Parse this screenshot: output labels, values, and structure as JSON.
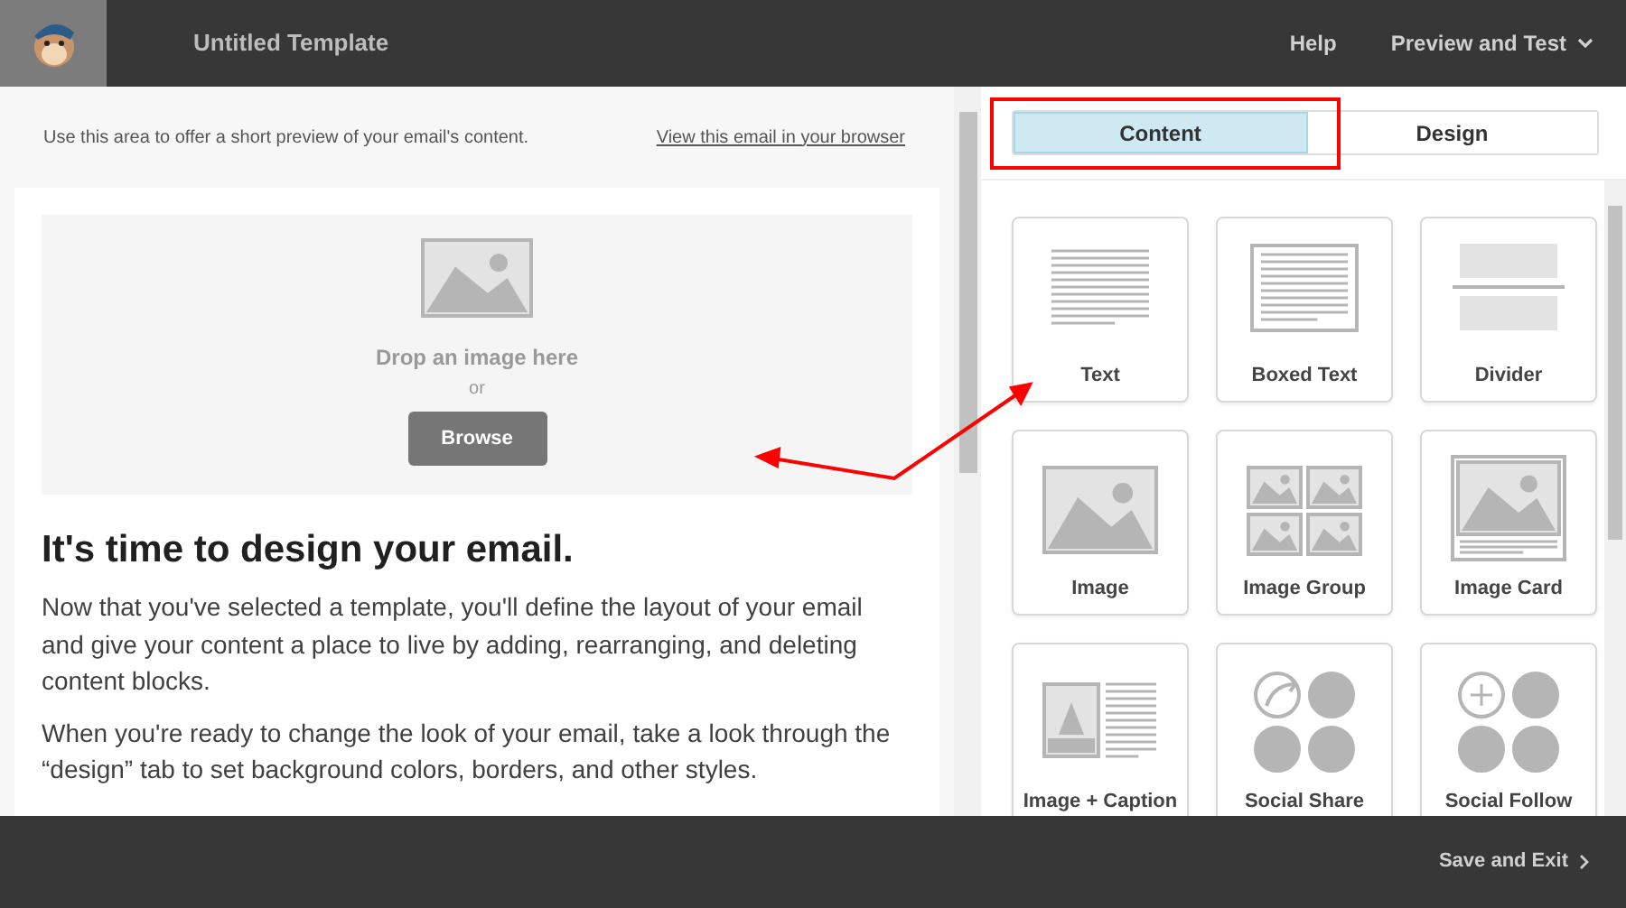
{
  "header": {
    "title": "Untitled Template",
    "help": "Help",
    "preview_menu": "Preview and Test"
  },
  "email": {
    "preheader": "Use this area to offer a short preview of your email's content.",
    "browser_link": "View this email in your browser",
    "image_drop": {
      "prompt": "Drop an image here",
      "or": "or",
      "button": "Browse"
    },
    "heading": "It's time to design your email.",
    "paragraphs": [
      "Now that you've selected a template, you'll define the layout of your email and give your content a place to live by adding, rearranging, and deleting content blocks.",
      "When you're ready to change the look of your email, take a look through the “design” tab to set background colors, borders, and other styles."
    ]
  },
  "tabs": [
    {
      "label": "Content",
      "selected": true
    },
    {
      "label": "Design",
      "selected": false
    }
  ],
  "blocks": [
    {
      "label": "Text",
      "kind": "text"
    },
    {
      "label": "Boxed Text",
      "kind": "boxed"
    },
    {
      "label": "Divider",
      "kind": "divider"
    },
    {
      "label": "Image",
      "kind": "image"
    },
    {
      "label": "Image Group",
      "kind": "group"
    },
    {
      "label": "Image Card",
      "kind": "card"
    },
    {
      "label": "Image + Caption",
      "kind": "caption"
    },
    {
      "label": "Social Share",
      "kind": "share"
    },
    {
      "label": "Social Follow",
      "kind": "follow"
    }
  ],
  "footer": {
    "save": "Save and Exit"
  }
}
